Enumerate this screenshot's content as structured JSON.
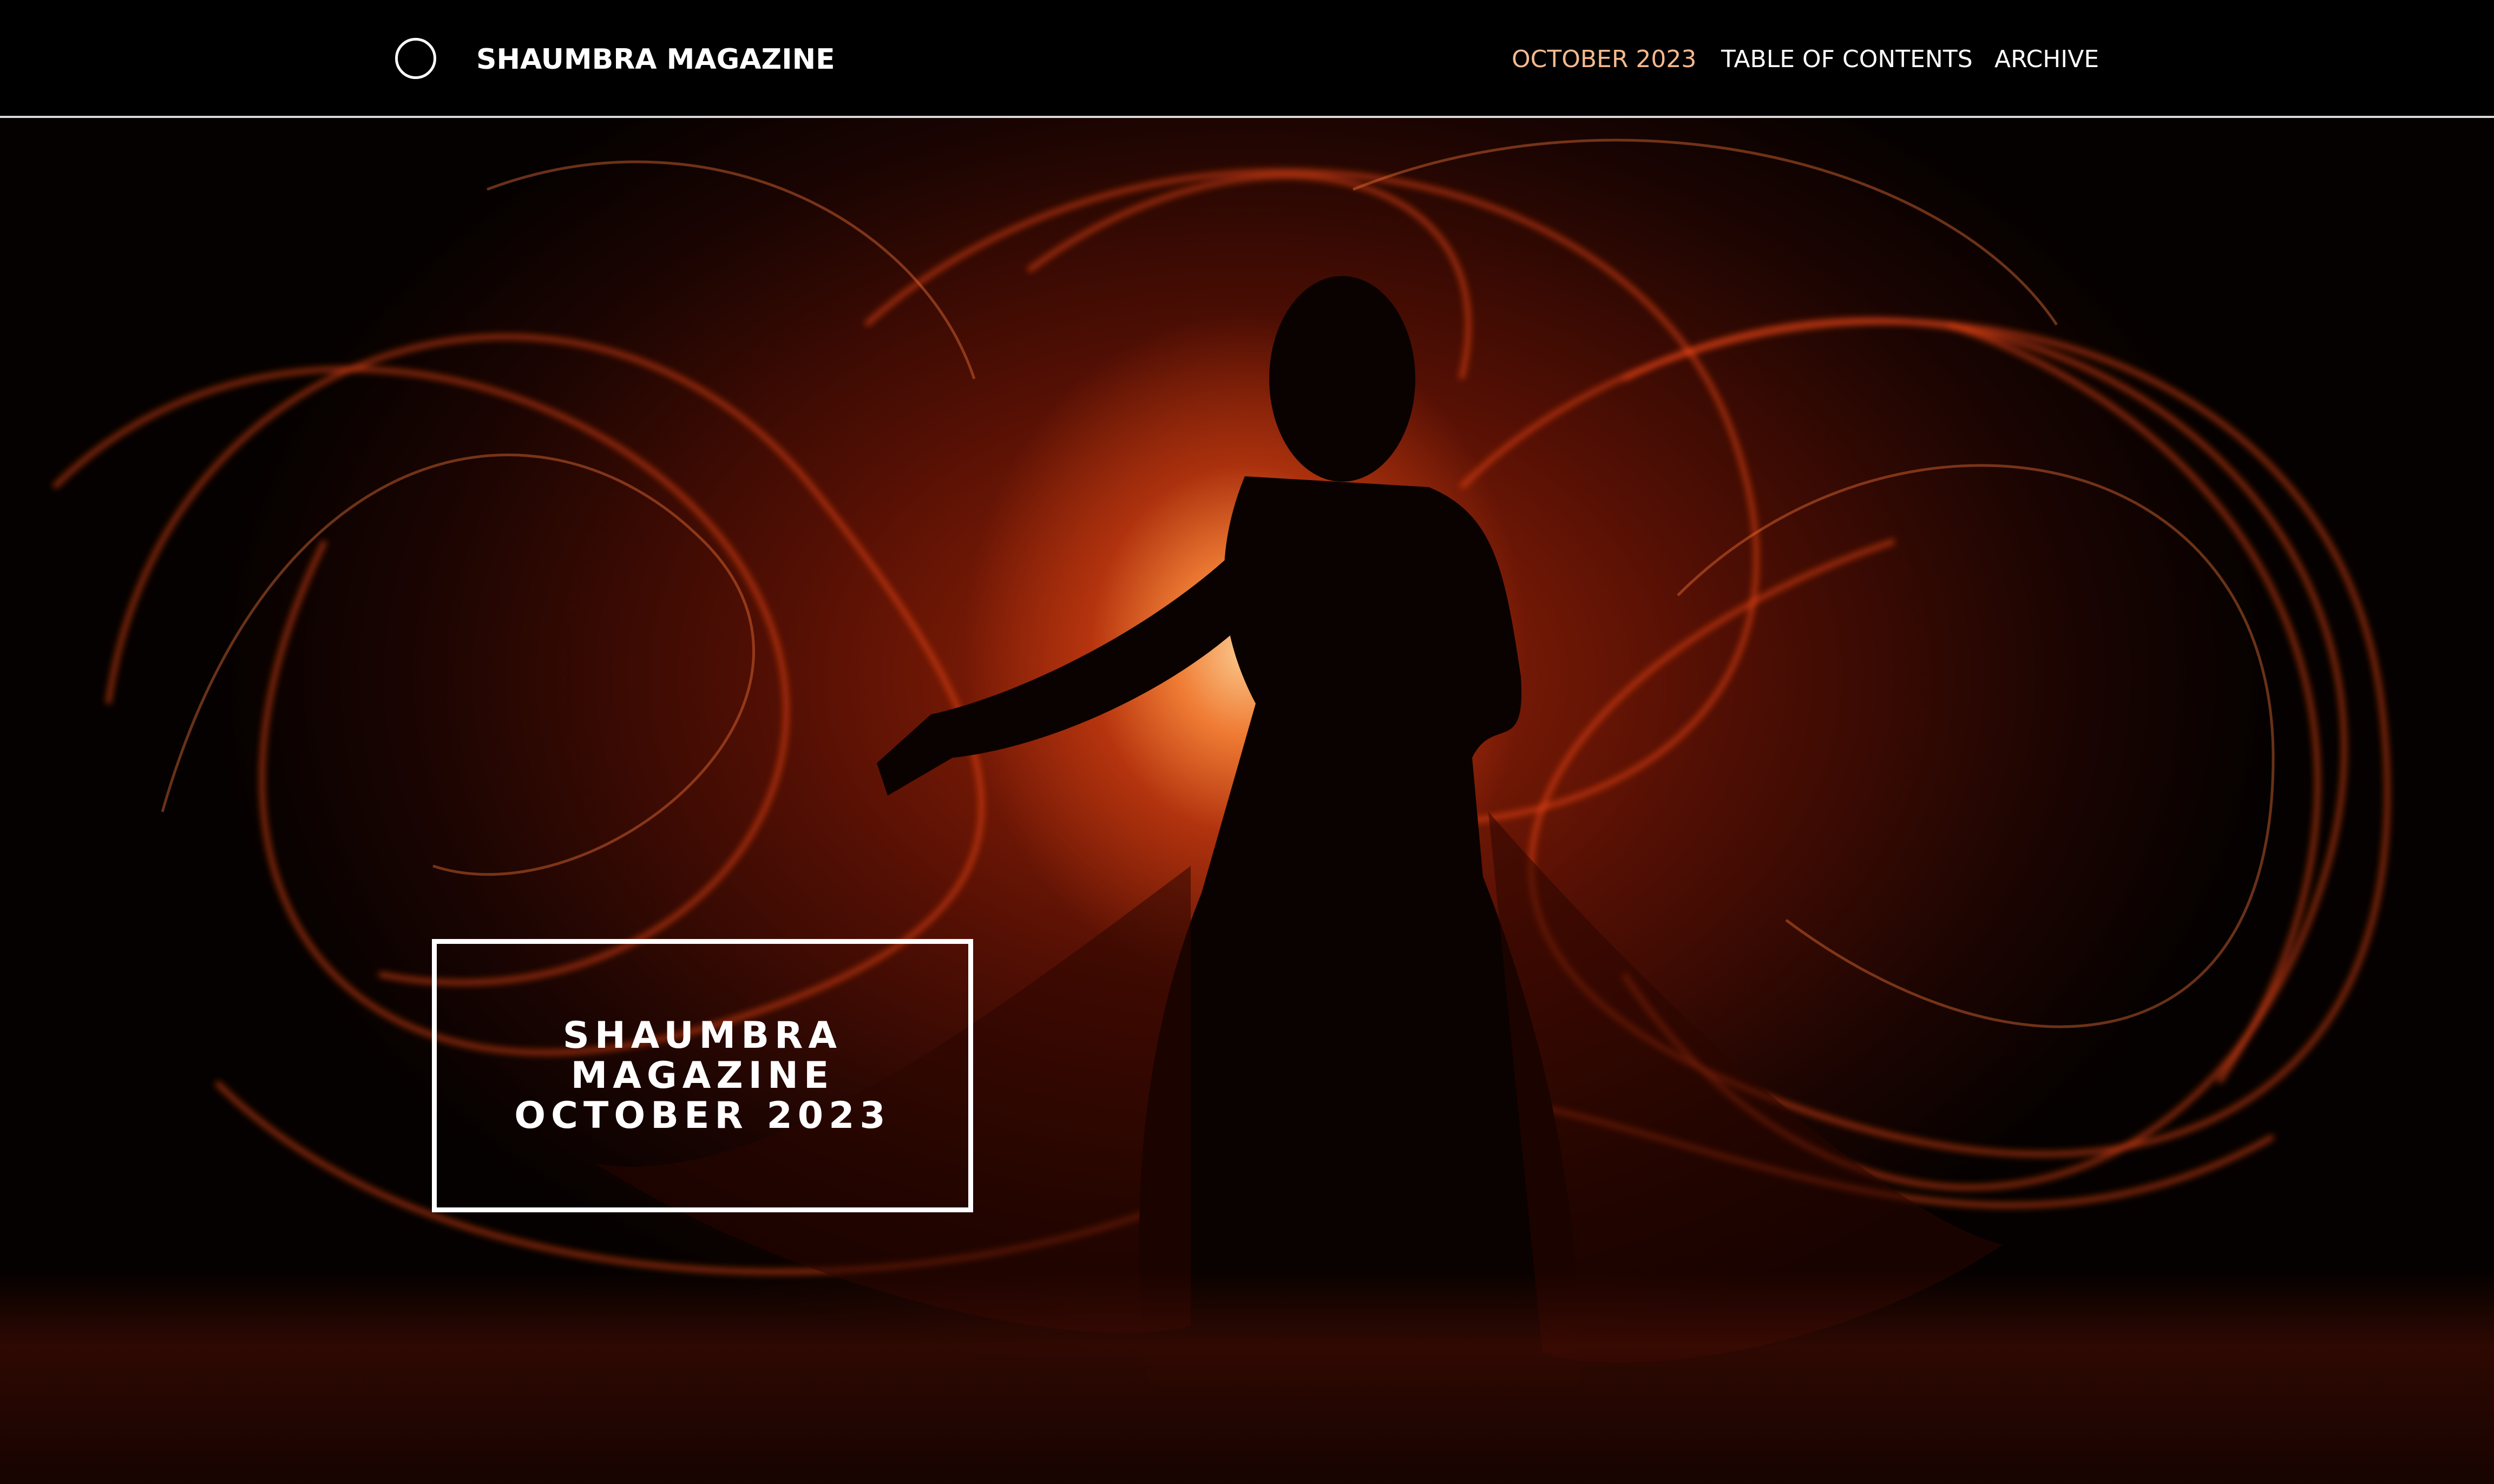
{
  "header": {
    "brand_icon": "circle-logo-icon",
    "brand_title": "SHAUMBRA MAGAZINE"
  },
  "nav": {
    "items": [
      {
        "label": "OCTOBER 2023",
        "active": true
      },
      {
        "label": "TABLE OF CONTENTS",
        "active": false
      },
      {
        "label": "ARCHIVE",
        "active": false
      }
    ]
  },
  "hero": {
    "title_lines": [
      "SHAUMBRA",
      "MAGAZINE",
      "OCTOBER 2023"
    ]
  },
  "colors": {
    "nav_active": "#f5b98f",
    "header_bg": "#000000",
    "hero_glow": "#ff8a3c"
  }
}
